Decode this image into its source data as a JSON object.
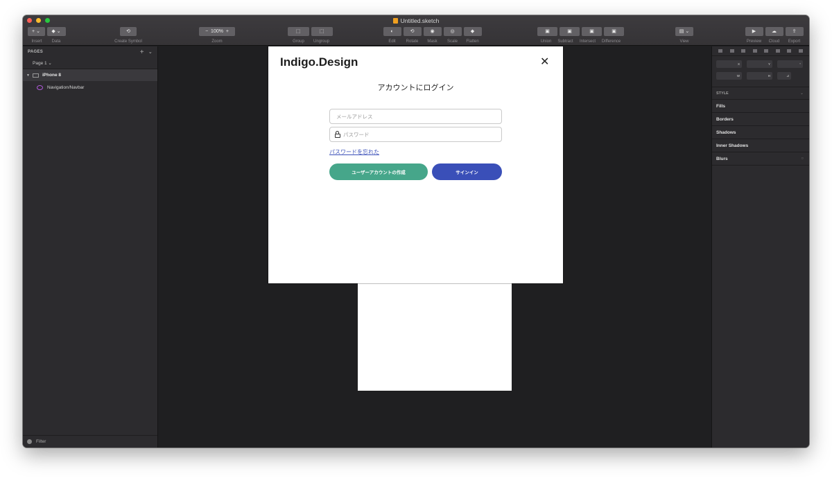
{
  "window": {
    "title": "Untitled.sketch"
  },
  "toolbar": {
    "insert": "Insert",
    "data": "Data",
    "create_symbol": "Create Symbol",
    "zoom_label": "Zoom",
    "zoom_value": "100%",
    "zoom_out": "−",
    "zoom_in": "+",
    "group": "Group",
    "ungroup": "Ungroup",
    "edit": "Edit",
    "rotate": "Rotate",
    "mask": "Mask",
    "scale": "Scale",
    "flatten": "Flatten",
    "union": "Union",
    "subtract": "Subtract",
    "intersect": "Intersect",
    "difference": "Difference",
    "view": "View",
    "preview": "Preview",
    "cloud": "Cloud",
    "export": "Export"
  },
  "pages_panel": {
    "header": "PAGES",
    "current_page": "Page 1",
    "artboard": "iPhone 8",
    "layer": "Navigation/Navbar",
    "filter": "Filter"
  },
  "modal": {
    "logo": "Indigo.Design",
    "close": "✕",
    "heading": "アカウントにログイン",
    "email_placeholder": "メールアドレス",
    "password_placeholder": "パスワード",
    "forgot_link": "パスワードを忘れた",
    "create_button": "ユーザーアカウントの作成",
    "signin_button": "サインイン"
  },
  "inspector": {
    "x": "X",
    "y": "Y",
    "w": "W",
    "h": "H",
    "style_header": "STYLE",
    "fills": "Fills",
    "borders": "Borders",
    "shadows": "Shadows",
    "inner_shadows": "Inner Shadows",
    "blurs": "Blurs"
  },
  "colors": {
    "create_button": "#46a68a",
    "signin_button": "#3a4fb8",
    "canvas": "#1f1f21"
  }
}
